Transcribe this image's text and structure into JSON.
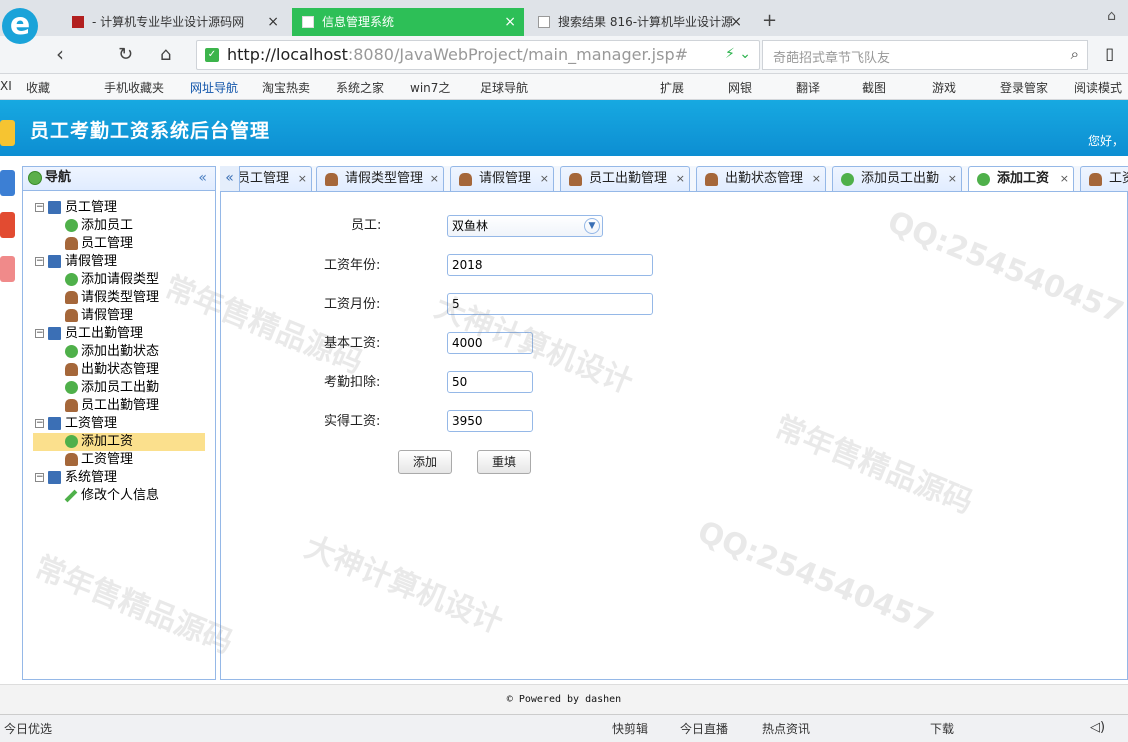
{
  "browser": {
    "tabs": [
      {
        "title": "- 计算机专业毕业设计源码网",
        "close": "×"
      },
      {
        "title": "信息管理系统",
        "close": "×"
      },
      {
        "title": "搜索结果 816-计算机毕业设计源",
        "close": "×"
      }
    ],
    "new_tab": "+",
    "url_host": "http://localhost",
    "url_rest": ":8080/JavaWebProject/main_manager.jsp#",
    "search_placeholder": "奇葩招式章节飞队友",
    "bookmarks_left": [
      "收藏",
      "手机收藏夹",
      "网址导航",
      "淘宝热卖",
      "系统之家",
      "win7之",
      "足球导航"
    ],
    "bookmarks_right": [
      "扩展",
      "网银",
      "翻译",
      "截图",
      "游戏",
      "登录管家",
      "阅读模式"
    ]
  },
  "app": {
    "title": "员工考勤工资系统后台管理",
    "greeting": "您好，"
  },
  "sidebar": {
    "title": "导航",
    "collapse": "«",
    "groups": [
      {
        "label": "员工管理",
        "toggle": "−",
        "items": [
          "添加员工",
          "员工管理"
        ]
      },
      {
        "label": "请假管理",
        "toggle": "−",
        "items": [
          "添加请假类型",
          "请假类型管理",
          "请假管理"
        ]
      },
      {
        "label": "员工出勤管理",
        "toggle": "−",
        "items": [
          "添加出勤状态",
          "出勤状态管理",
          "添加员工出勤",
          "员工出勤管理"
        ]
      },
      {
        "label": "工资管理",
        "toggle": "−",
        "items": [
          "添加工资",
          "工资管理"
        ]
      },
      {
        "label": "系统管理",
        "toggle": "−",
        "items": [
          "修改个人信息"
        ]
      }
    ],
    "selected": "添加工资"
  },
  "tabs": {
    "scroll_left": "«",
    "items": [
      "员工管理",
      "请假类型管理",
      "请假管理",
      "员工出勤管理",
      "出勤状态管理",
      "添加员工出勤",
      "添加工资",
      "工资"
    ],
    "close": "×",
    "active": "添加工资"
  },
  "form": {
    "employee_label": "员工:",
    "employee_value": "双鱼林",
    "year_label": "工资年份:",
    "year_value": "2018",
    "month_label": "工资月份:",
    "month_value": "5",
    "base_label": "基本工资:",
    "base_value": "4000",
    "deduct_label": "考勤扣除:",
    "deduct_value": "50",
    "actual_label": "实得工资:",
    "actual_value": "3950",
    "add_button": "添加",
    "reset_button": "重填"
  },
  "footer": "© Powered by dashen",
  "statusbar": {
    "left": "今日优选",
    "right": [
      "快剪辑",
      "今日直播",
      "热点资讯",
      "下载"
    ]
  },
  "watermarks": [
    "QQ:254540457",
    "常年售精品源码",
    "大神计算机设计"
  ]
}
